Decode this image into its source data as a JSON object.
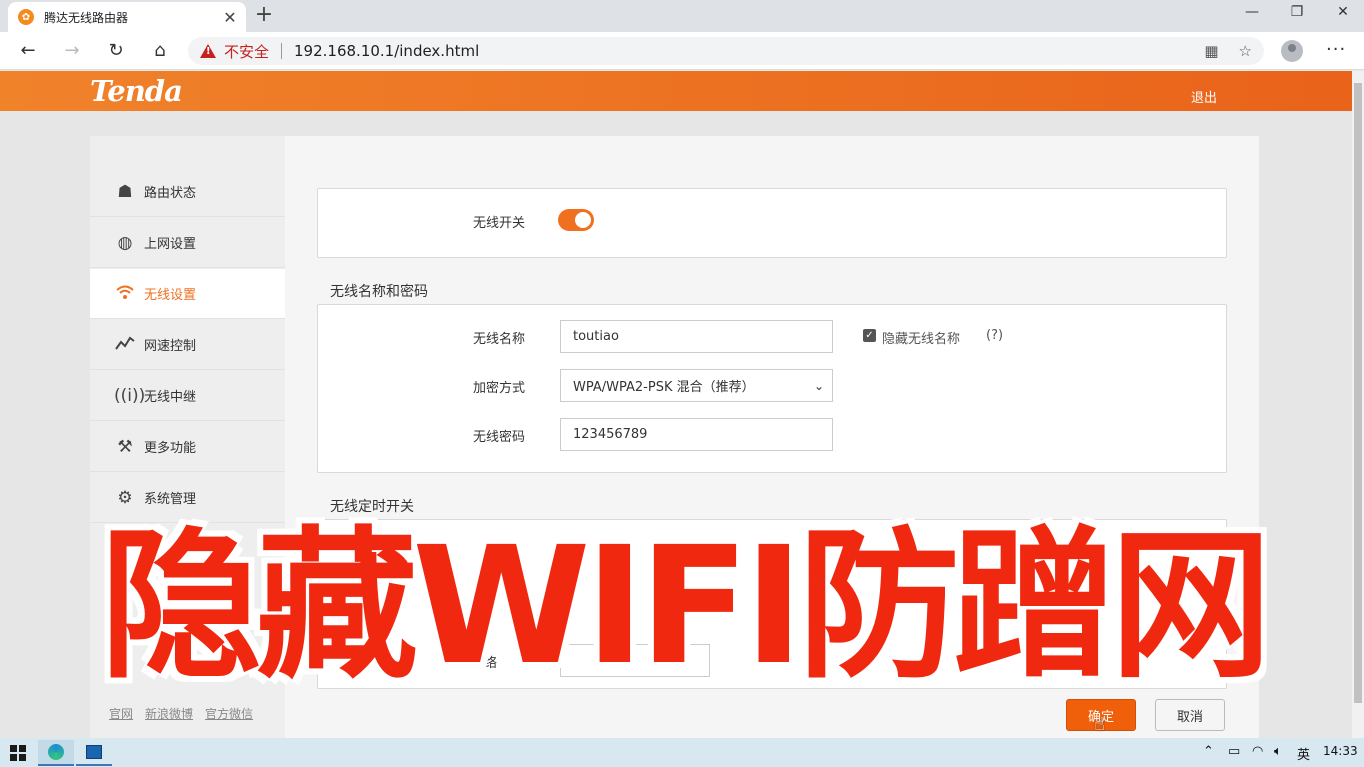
{
  "browser": {
    "tab_title": "腾达无线路由器",
    "tab_close": "✕",
    "new_tab": "+",
    "insecure_label": "不安全",
    "url": "192.168.10.1/index.html",
    "window_controls": [
      "—",
      "❐",
      "✕"
    ]
  },
  "header": {
    "logo": "Tenda",
    "logout": "退出"
  },
  "sidebar": {
    "items": [
      {
        "label": "路由状态",
        "icon": "router-icon"
      },
      {
        "label": "上网设置",
        "icon": "globe-icon"
      },
      {
        "label": "无线设置",
        "icon": "wifi-icon"
      },
      {
        "label": "网速控制",
        "icon": "speed-chart-icon"
      },
      {
        "label": "无线中继",
        "icon": "antenna-icon"
      },
      {
        "label": "更多功能",
        "icon": "tools-icon"
      },
      {
        "label": "系统管理",
        "icon": "gears-icon"
      }
    ],
    "active_index": 2,
    "footer_links": [
      "官网",
      "新浪微博",
      "官方微信"
    ]
  },
  "wireless": {
    "switch_label": "无线开关",
    "switch_on": true,
    "name_section_title": "无线名称和密码",
    "ssid_label": "无线名称",
    "ssid_value": "toutiao",
    "hide_ssid_label": "隐藏无线名称",
    "hide_ssid_checked": true,
    "help_glyph": "(?)",
    "encryption_label": "加密方式",
    "encryption_value": "WPA/WPA2-PSK 混合（推荐）",
    "password_label": "无线密码",
    "password_value": "123456789",
    "schedule_section_title": "无线定时开关",
    "partial_label": "络"
  },
  "buttons": {
    "ok": "确定",
    "cancel": "取消"
  },
  "overlay": {
    "banner_text": "隐藏WIFI防蹭网"
  },
  "taskbar": {
    "ime": "英",
    "clock": "14:33"
  },
  "colors": {
    "brand_orange": "#f07020",
    "banner_red": "#f02810",
    "insecure_red": "#c5221f"
  }
}
